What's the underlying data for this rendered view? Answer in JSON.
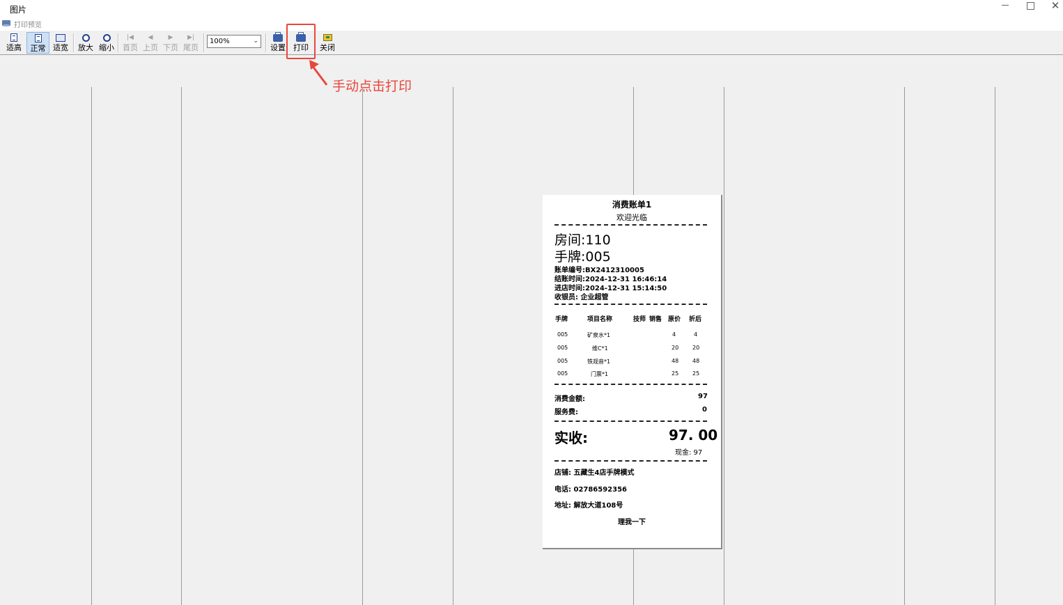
{
  "window": {
    "title": "图片",
    "subtitle": "打印预览"
  },
  "toolbar": {
    "fit_height": "适高",
    "normal": "正常",
    "fit_width": "适宽",
    "zoom_in": "放大",
    "zoom_out": "缩小",
    "first_page": "首页",
    "prev_page": "上页",
    "next_page": "下页",
    "last_page": "尾页",
    "zoom_level": "100%",
    "settings": "设置",
    "print": "打印",
    "close": "关闭"
  },
  "annotation": {
    "text": "手动点击打印",
    "color": "#e8473c"
  },
  "receipt": {
    "title": "消费账单1",
    "welcome": "欢迎光临",
    "room": "房间:110",
    "tag": "手牌:005",
    "bill_no": "账单编号:BX2412310005",
    "checkout_time": "结账时间:2024-12-31  16:46:14",
    "checkin_time": "进店时间:2024-12-31  15:14:50",
    "cashier": "收银员:  企业超管",
    "columns": [
      "手牌",
      "项目名称",
      "技师",
      "销售",
      "原价",
      "折后"
    ],
    "items": [
      {
        "tag": "005",
        "name": "矿泉水*1",
        "tech": "",
        "sales": "",
        "price": "4",
        "discounted": "4"
      },
      {
        "tag": "005",
        "name": "维C*1",
        "tech": "",
        "sales": "",
        "price": "20",
        "discounted": "20"
      },
      {
        "tag": "005",
        "name": "铁观音*1",
        "tech": "",
        "sales": "",
        "price": "48",
        "discounted": "48"
      },
      {
        "tag": "005",
        "name": "门票*1",
        "tech": "",
        "sales": "",
        "price": "25",
        "discounted": "25"
      }
    ],
    "consume_label": "消费金额:",
    "consume_value": "97",
    "service_label": "服务费:",
    "service_value": "0",
    "received_label": "实收:",
    "received_value": "97. 00",
    "cash": "现金: 97",
    "shop": "店铺:  五藏生4店手牌模式",
    "phone": "电话:  02786592356",
    "address": "地址:  解放大道108号",
    "footer": "理我一下"
  }
}
